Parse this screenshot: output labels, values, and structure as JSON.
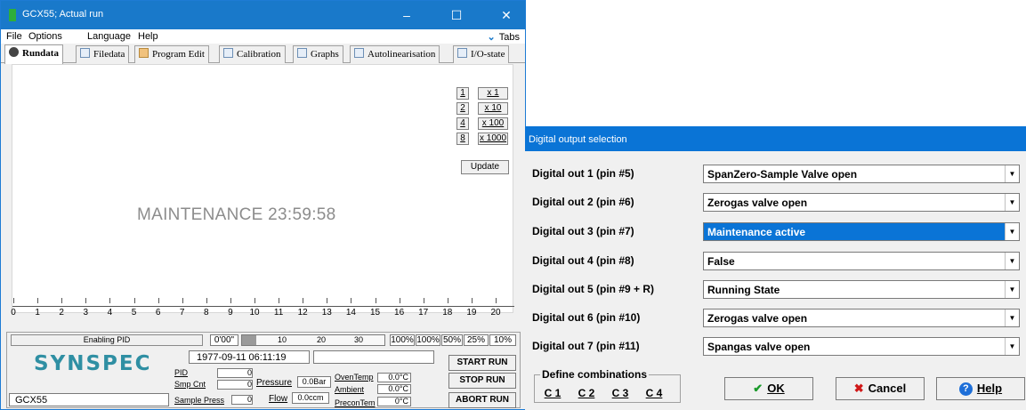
{
  "window": {
    "title": "GCX55; Actual run",
    "controls": [
      "–",
      "☐",
      "✕"
    ]
  },
  "menu": {
    "file": "File",
    "options": "Options",
    "language": "Language",
    "help": "Help",
    "tabs_toggle": "Tabs"
  },
  "tabs": [
    {
      "label": "Rundata",
      "icon": "gear-icon"
    },
    {
      "label": "Filedata",
      "icon": "list-icon"
    },
    {
      "label": "Program Edit",
      "icon": "wrench-icon"
    },
    {
      "label": "Calibration",
      "icon": "chart-icon"
    },
    {
      "label": "Graphs",
      "icon": "chart-icon"
    },
    {
      "label": "Autolinearisation",
      "icon": "chart-icon"
    },
    {
      "label": "I/O-state",
      "icon": "io-icon"
    }
  ],
  "plot": {
    "zoom": [
      {
        "key": "1",
        "label": "x 1"
      },
      {
        "key": "2",
        "label": "x 10"
      },
      {
        "key": "4",
        "label": "x 100"
      },
      {
        "key": "8",
        "label": "x 1000"
      }
    ],
    "update_label": "Update",
    "status_text": "MAINTENANCE 23:59:58",
    "x_ticks": [
      "0",
      "1",
      "2",
      "3",
      "4",
      "5",
      "6",
      "7",
      "8",
      "9",
      "10",
      "11",
      "12",
      "13",
      "14",
      "15",
      "16",
      "17",
      "18",
      "19",
      "20"
    ]
  },
  "panel": {
    "status": "Enabling PID",
    "timer": "0'00\"",
    "progress_ticks": [
      "10",
      "20",
      "30"
    ],
    "progress_fraction": 0.1,
    "percent_buttons": [
      "100%",
      "100%",
      "50%",
      "25%",
      "10%"
    ],
    "logo": "SYNSPEC",
    "datetime": "1977-09-11   06:11:19",
    "message": "",
    "instrument": "GCX55",
    "pid_label": "PID",
    "pid_value": "0",
    "smp_cnt_label": "Smp Cnt",
    "smp_cnt_value": "0",
    "sample_press_label": "Sample Press",
    "sample_press_value": "0",
    "pressure_label": "Pressure",
    "pressure_value": "0.0Bar",
    "flow_label": "Flow",
    "flow_value": "0.0ccm",
    "oventemp_label": "OvenTemp",
    "oventemp_value": "0.0°C",
    "ambient_label": "Ambient",
    "ambient_value": "0.0°C",
    "precon_label": "PreconTem",
    "precon_value": "0°C",
    "start_run": "START RUN",
    "stop_run": "STOP RUN",
    "abort_run": "ABORT RUN"
  },
  "dialog": {
    "title": "Digital output selection",
    "rows": [
      {
        "label": "Digital out 1 (pin #5)",
        "value": "SpanZero-Sample Valve open",
        "selected": false
      },
      {
        "label": "Digital out 2 (pin #6)",
        "value": "Zerogas valve open",
        "selected": false
      },
      {
        "label": "Digital out 3 (pin #7)",
        "value": "Maintenance active",
        "selected": true
      },
      {
        "label": "Digital out 4 (pin #8)",
        "value": "False",
        "selected": false
      },
      {
        "label": "Digital out 5 (pin #9 + R)",
        "value": "Running State",
        "selected": false
      },
      {
        "label": "Digital out 6 (pin #10)",
        "value": "Zerogas valve open",
        "selected": false
      },
      {
        "label": "Digital out 7 (pin #11)",
        "value": "Spangas valve open",
        "selected": false
      }
    ],
    "combinations_title": "Define combinations",
    "combinations": [
      "C 1",
      "C 2",
      "C 3",
      "C 4"
    ],
    "ok": "OK",
    "cancel": "Cancel",
    "help": "Help",
    "colors": {
      "accent": "#0a74d6",
      "ok_check": "#1a9a2a",
      "cancel_x": "#d01818",
      "help_icon": "#1e6fd8"
    }
  }
}
